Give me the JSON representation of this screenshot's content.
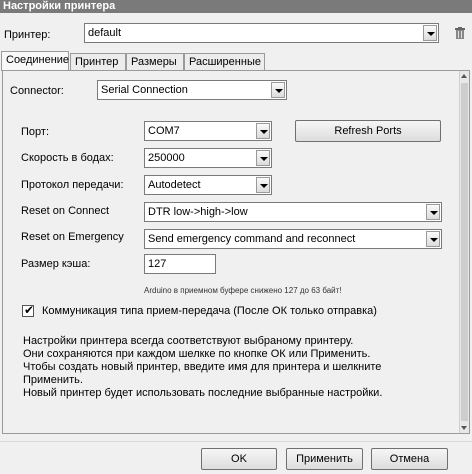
{
  "window": {
    "title": "Настройки принтера"
  },
  "printer": {
    "label": "Принтер:",
    "value": "default",
    "delete_icon": "trash-icon"
  },
  "tabs": [
    {
      "label": "Соединение",
      "active": true
    },
    {
      "label": "Принтер",
      "active": false
    },
    {
      "label": "Размеры",
      "active": false
    },
    {
      "label": "Расширенные",
      "active": false
    }
  ],
  "connection": {
    "connector_label": "Connector:",
    "connector_value": "Serial Connection",
    "port_label": "Порт:",
    "port_value": "COM7",
    "refresh_label": "Refresh Ports",
    "baud_label": "Скорость в бодах:",
    "baud_value": "250000",
    "protocol_label": "Протокол передачи:",
    "protocol_value": "Autodetect",
    "reset_connect_label": "Reset on Connect",
    "reset_connect_value": "DTR low->high->low",
    "reset_emergency_label": "Reset on Emergency",
    "reset_emergency_value": "Send emergency command and reconnect",
    "cache_label": "Размер кэша:",
    "cache_value": "127",
    "cache_note": "Arduino в приемном буфере снижено 127 до 63 байт!",
    "pingpong_checked": true,
    "pingpong_label": "Коммуникация типа прием-передача (После ОК только отправка)",
    "info_lines": [
      "Настройки принтера всегда соответствуют выбраному принтеру.",
      "Они сохраняются при каждом шелкке по кнопке ОК или Применить.",
      "Чтобы создать новый принтер, введите имя для принтера и шелкните",
      "Применить.",
      "Новый принтер будет использовать последние выбранные настройки."
    ]
  },
  "buttons": {
    "ok": "OK",
    "apply": "Применить",
    "cancel": "Отмена"
  }
}
